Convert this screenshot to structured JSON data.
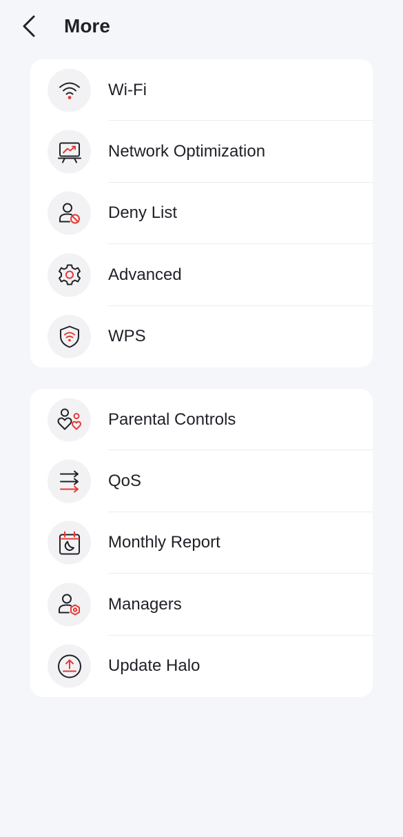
{
  "header": {
    "title": "More",
    "back_icon": "chevron-left-icon"
  },
  "colors": {
    "accent": "#e53935",
    "icon_stroke": "#1f2127",
    "background": "#f4f6fa",
    "card": "#ffffff",
    "icon_circle": "#f2f2f4"
  },
  "sections": [
    {
      "items": [
        {
          "label": "Wi-Fi",
          "icon": "wifi-icon"
        },
        {
          "label": "Network Optimization",
          "icon": "monitor-chart-icon"
        },
        {
          "label": "Deny List",
          "icon": "user-blocked-icon"
        },
        {
          "label": "Advanced",
          "icon": "gear-icon"
        },
        {
          "label": "WPS",
          "icon": "shield-wifi-icon"
        }
      ]
    },
    {
      "items": [
        {
          "label": "Parental Controls",
          "icon": "parent-child-icon"
        },
        {
          "label": "QoS",
          "icon": "arrows-right-icon"
        },
        {
          "label": "Monthly Report",
          "icon": "calendar-moon-icon"
        },
        {
          "label": "Managers",
          "icon": "user-gear-icon"
        },
        {
          "label": "Update Halo",
          "icon": "upload-circle-icon"
        }
      ]
    }
  ]
}
